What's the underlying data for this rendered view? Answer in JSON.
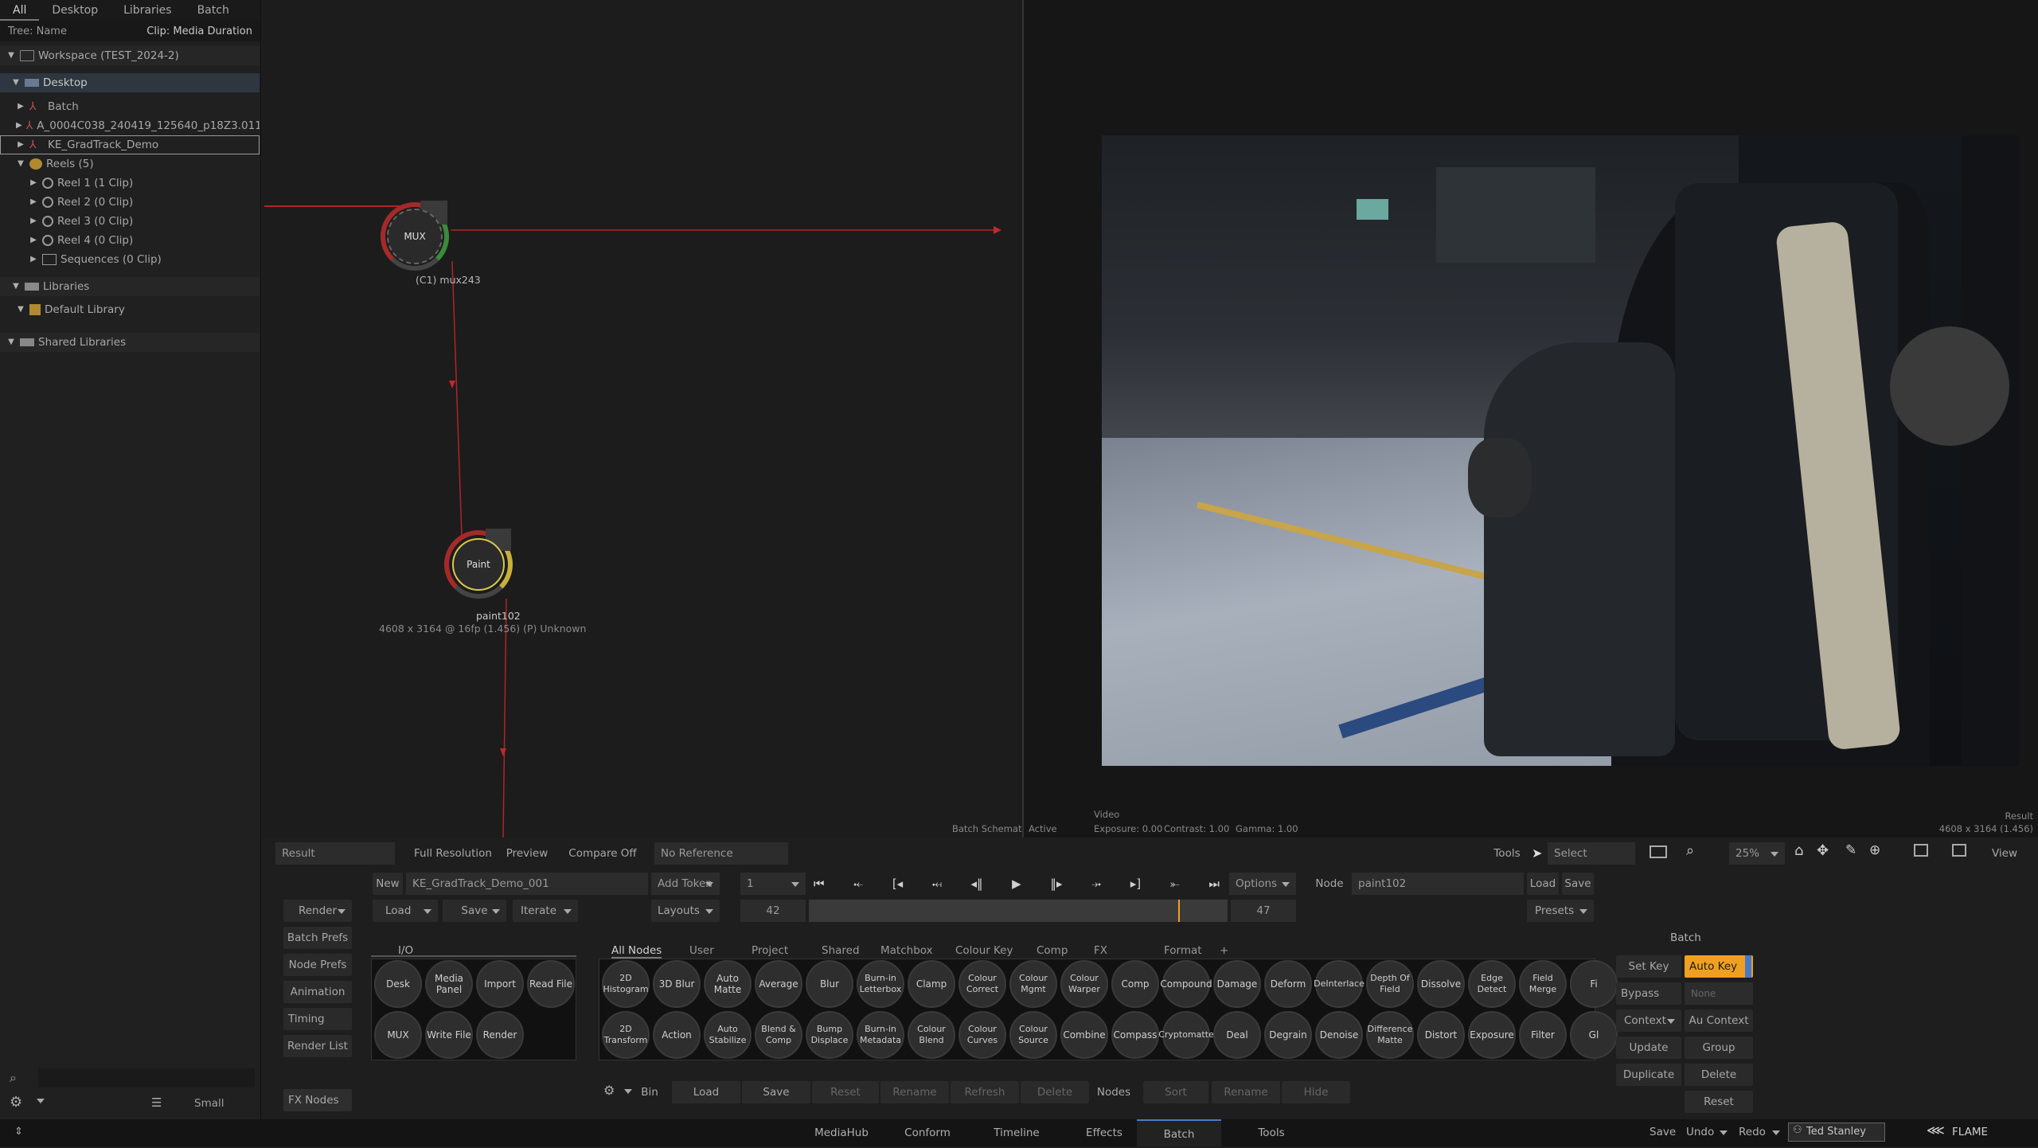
{
  "left_panel": {
    "tabs": [
      "All",
      "Desktop",
      "Libraries",
      "Batch"
    ],
    "tree_header": {
      "left": "Tree: Name",
      "right": "Clip: Media Duration"
    },
    "items": {
      "workspace": "Workspace (TEST_2024-2)",
      "desktop": "Desktop",
      "batch": "Batch",
      "clip": "A_0004C038_240419_125640_p18Z3.0112",
      "ke": "KE_GradTrack_Demo",
      "reels": "Reels (5)",
      "reel1": "Reel 1 (1 Clip)",
      "reel2": "Reel 2 (0 Clip)",
      "reel3": "Reel 3 (0 Clip)",
      "reel4": "Reel 4 (0 Clip)",
      "seq": "Sequences (0 Clip)",
      "libraries": "Libraries",
      "defaultlib": "Default Library",
      "shared": "Shared Libraries"
    },
    "size_label": "Small"
  },
  "schematic": {
    "mux_node": "MUX",
    "mux_label": "(C1) mux243",
    "paint_node": "Paint",
    "paint_label": "paint102",
    "paint_info": "4608 x 3164 @ 16fp (1.456) (P) Unknown",
    "footer": "Batch Schematic"
  },
  "viewer": {
    "active": "Active",
    "video": "Video",
    "exposure": "Exposure: 0.00",
    "contrast": "Contrast: 1.00",
    "gamma": "Gamma: 1.00",
    "result": "Result",
    "res": "4608 x 3164 (1.456)"
  },
  "toolbar": {
    "result": "Result",
    "full_res": "Full Resolution",
    "preview": "Preview",
    "compare": "Compare Off",
    "reference": "No Reference",
    "tools": "Tools",
    "select": "Select",
    "zoom": "25%",
    "view": "View"
  },
  "batch_controls": {
    "new": "New",
    "name": "KE_GradTrack_Demo_001",
    "add_token": "Add Token",
    "frame": "1",
    "options": "Options",
    "node_label": "Node",
    "node_name": "paint102",
    "load": "Load",
    "save": "Save",
    "render": "Render",
    "load2": "Load",
    "save2": "Save",
    "iterate": "Iterate",
    "layouts": "Layouts",
    "start": "42",
    "end": "47",
    "presets": "Presets",
    "batch_prefs": "Batch Prefs",
    "node_prefs": "Node Prefs",
    "animation": "Animation",
    "timing": "Timing",
    "render_list": "Render List",
    "fx_nodes": "FX Nodes"
  },
  "io": {
    "title": "I/O",
    "nodes": [
      "Desk",
      "Media Panel",
      "Import",
      "Read File",
      "MUX",
      "Write File",
      "Render"
    ]
  },
  "node_tabs": [
    "All Nodes",
    "User",
    "Project",
    "Shared",
    "Matchbox",
    "Colour",
    "Key",
    "Comp",
    "FX",
    "Format",
    "+"
  ],
  "nodes_row1": [
    "2D Histogram",
    "3D Blur",
    "Auto Matte",
    "Average",
    "Blur",
    "Burn-in Letterbox",
    "Clamp",
    "Colour Correct",
    "Colour Mgmt",
    "Colour Warper",
    "Comp",
    "Compound",
    "Damage",
    "Deform",
    "DeInterlace",
    "Depth Of Field",
    "Dissolve",
    "Edge Detect",
    "Field Merge",
    "Fi"
  ],
  "nodes_row2": [
    "2D Transform",
    "Action",
    "Auto Stabilize",
    "Blend & Comp",
    "Bump Displace",
    "Burn-in Metadata",
    "Colour Blend",
    "Colour Curves",
    "Colour Source",
    "Combine",
    "Compass",
    "Cryptomatte",
    "Deal",
    "Degrain",
    "Denoise",
    "Difference Matte",
    "Distort",
    "Exposure",
    "Filter",
    "Gl"
  ],
  "bin_bar": {
    "bin": "Bin",
    "load": "Load",
    "save": "Save",
    "reset": "Reset",
    "rename": "Rename",
    "refresh": "Refresh",
    "delete": "Delete",
    "nodes": "Nodes",
    "sort": "Sort",
    "rename2": "Rename",
    "hide": "Hide"
  },
  "batch_side": {
    "title": "Batch",
    "set_key": "Set Key",
    "auto_key": "Auto Key",
    "bypass": "Bypass",
    "none": "None",
    "context": "Context",
    "au_context": "Au Context",
    "update": "Update",
    "group": "Group",
    "duplicate": "Duplicate",
    "delete": "Delete",
    "reset": "Reset"
  },
  "status": {
    "tabs": [
      "MediaHub",
      "Conform",
      "Timeline",
      "Effects",
      "Batch",
      "Tools"
    ],
    "active": "Batch",
    "save": "Save",
    "undo": "Undo",
    "redo": "Redo",
    "user": "Ted Stanley",
    "app": "FLAME"
  },
  "colors": {
    "accent_orange": "#f0a020",
    "wire_red": "#c0282c",
    "node_yellow": "#d8c84a"
  }
}
